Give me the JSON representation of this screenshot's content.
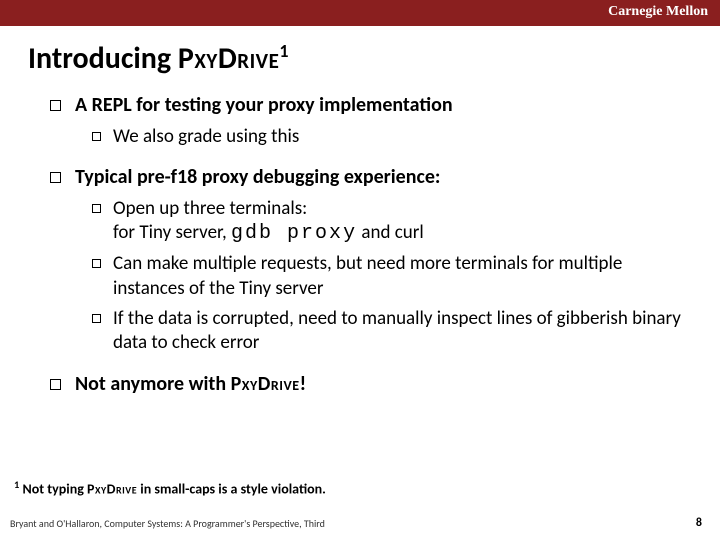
{
  "header": {
    "org": "Carnegie Mellon"
  },
  "title": {
    "prefix": "Introducing ",
    "name_part1": "P",
    "name_part2": "xy",
    "name_part3": "D",
    "name_part4": "rive",
    "sup": "1"
  },
  "bullets": {
    "b1": "A REPL for testing your proxy implementation",
    "b1a": "We also grade using this",
    "b2": "Typical pre-f18 proxy debugging experience:",
    "b2a_line1": "Open up three terminals:",
    "b2a_line2a": "for Tiny server, ",
    "b2a_mono": "gdb proxy",
    "b2a_line2b": " and curl",
    "b2b": "Can make multiple requests, but need more terminals for multiple instances of the Tiny server",
    "b2c": "If the data is corrupted, need to manually inspect lines of gibberish binary data to check error",
    "b3a": "Not anymore with ",
    "b3_name_p1": "P",
    "b3_name_p2": "xy",
    "b3_name_p3": "D",
    "b3_name_p4": "rive",
    "b3b": "!"
  },
  "footnote": {
    "sup": "1",
    "t1": " Not typing ",
    "name_p1": "P",
    "name_p2": "xy",
    "name_p3": "D",
    "name_p4": "rive",
    "t2": " in small-caps is a style violation."
  },
  "footer": {
    "left": "Bryant and O'Hallaron, Computer Systems: A Programmer's Perspective, Third",
    "page": "8"
  }
}
